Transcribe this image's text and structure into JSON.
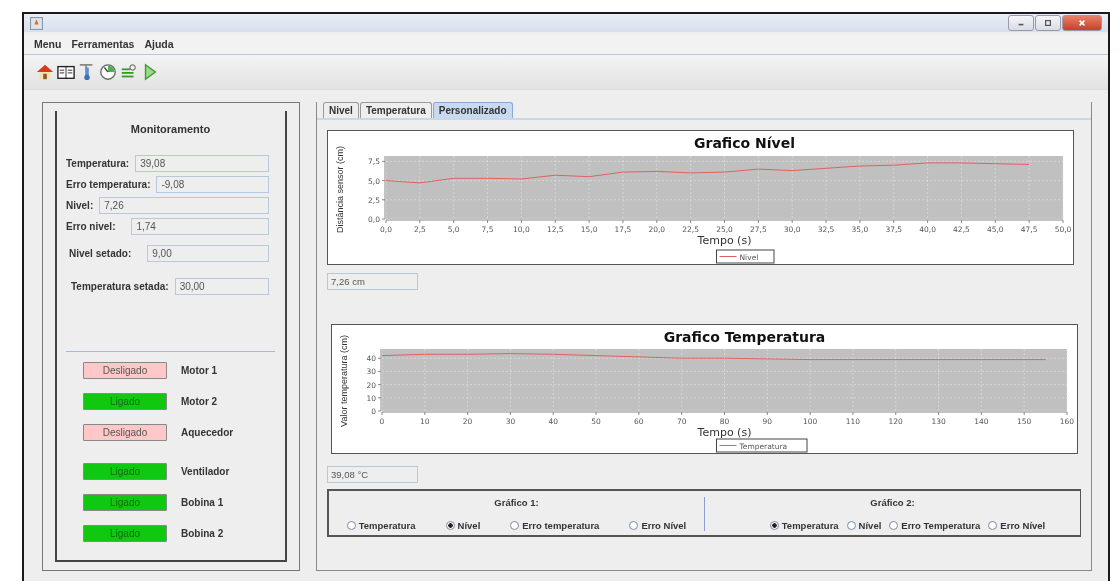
{
  "menu": [
    "Menu",
    "Ferramentas",
    "Ajuda"
  ],
  "monitor": {
    "title": "Monitoramento",
    "fields": [
      {
        "label": "Temperatura:",
        "value": "39,08"
      },
      {
        "label": "Erro temperatura:",
        "value": "-9,08"
      },
      {
        "label": "Nivel:",
        "value": "7,26"
      },
      {
        "label": "Erro nivel:",
        "value": "1,74"
      },
      {
        "label": "Nivel setado:",
        "value": "9,00"
      },
      {
        "label": "Temperatura setada:",
        "value": "30,00"
      }
    ],
    "devices": [
      {
        "button": "Desligado",
        "on": false,
        "name": "Motor 1"
      },
      {
        "button": "Ligado",
        "on": true,
        "name": "Motor 2"
      },
      {
        "button": "Desligado",
        "on": false,
        "name": "Aquecedor"
      },
      {
        "button": "Ligado",
        "on": true,
        "name": "Ventilador"
      },
      {
        "button": "Ligado",
        "on": true,
        "name": "Bobina 1"
      },
      {
        "button": "Ligado",
        "on": true,
        "name": "Bobina 2"
      }
    ]
  },
  "tabs": [
    {
      "label": "Nivel",
      "selected": false
    },
    {
      "label": "Temperatura",
      "selected": false
    },
    {
      "label": "Personalizado",
      "selected": true
    }
  ],
  "charts": [
    {
      "chart_data": {
        "type": "line",
        "title": "Grafico Nível",
        "xlabel": "Tempo (s)",
        "ylabel": "Distância sensor (cm)",
        "x": [
          0,
          2.5,
          5,
          7.5,
          10,
          12.5,
          15,
          17.5,
          20,
          22.5,
          25,
          27.5,
          30,
          32.5,
          35,
          37.5,
          40,
          42.5,
          45,
          47.5
        ],
        "series": [
          {
            "name": "Nivel",
            "color": "#e06060",
            "values": [
              5.0,
              4.7,
              5.3,
              5.3,
              5.2,
              5.7,
              5.5,
              6.1,
              6.2,
              6.0,
              6.1,
              6.5,
              6.3,
              6.6,
              6.9,
              7.0,
              7.3,
              7.3,
              7.2,
              7.1
            ]
          }
        ],
        "xlim": [
          0,
          50
        ],
        "ylim": [
          0,
          8.2
        ],
        "grid": true,
        "xticks": [
          {
            "value": 0,
            "label": "0,0"
          },
          {
            "value": 2.5,
            "label": "2,5"
          },
          {
            "value": 5,
            "label": "5,0"
          },
          {
            "value": 7.5,
            "label": "7,5"
          },
          {
            "value": 10,
            "label": "10,0"
          },
          {
            "value": 12.5,
            "label": "12,5"
          },
          {
            "value": 15,
            "label": "15,0"
          },
          {
            "value": 17.5,
            "label": "17,5"
          },
          {
            "value": 20,
            "label": "20,0"
          },
          {
            "value": 22.5,
            "label": "22,5"
          },
          {
            "value": 25,
            "label": "25,0"
          },
          {
            "value": 27.5,
            "label": "27,5"
          },
          {
            "value": 30,
            "label": "30,0"
          },
          {
            "value": 32.5,
            "label": "32,5"
          },
          {
            "value": 35,
            "label": "35,0"
          },
          {
            "value": 37.5,
            "label": "37,5"
          },
          {
            "value": 40,
            "label": "40,0"
          },
          {
            "value": 42.5,
            "label": "42,5"
          },
          {
            "value": 45,
            "label": "45,0"
          },
          {
            "value": 47.5,
            "label": "47,5"
          },
          {
            "value": 50,
            "label": "50,0"
          }
        ],
        "yticks": [
          {
            "value": 0,
            "label": "0,0"
          },
          {
            "value": 2.5,
            "label": "2,5"
          },
          {
            "value": 5,
            "label": "5,0"
          },
          {
            "value": 7.5,
            "label": "7,5"
          }
        ]
      },
      "reading": "7,26 cm"
    },
    {
      "chart_data": {
        "type": "line",
        "title": "Grafico Temperatura",
        "xlabel": "Tempo (s)",
        "ylabel": "Valor temperatura (cm)",
        "x": [
          0,
          10,
          20,
          30,
          40,
          50,
          60,
          70,
          80,
          90,
          100,
          110,
          120,
          130,
          140,
          150,
          155
        ],
        "series": [
          {
            "name": "Temperatura",
            "color": "#e06060",
            "values": [
              42,
              43,
              43,
              43.5,
              43,
              42,
              41,
              40,
              40,
              39.5,
              39,
              39,
              39,
              39,
              39,
              39,
              39
            ]
          }
        ],
        "xlim": [
          0,
          160
        ],
        "ylim": [
          0,
          47
        ],
        "grid": true,
        "xticks": [
          0,
          10,
          20,
          30,
          40,
          50,
          60,
          70,
          80,
          90,
          100,
          110,
          120,
          130,
          140,
          150,
          160
        ],
        "yticks": [
          0,
          10,
          20,
          30,
          40
        ]
      },
      "reading": "39,08 °C"
    }
  ],
  "selectors": [
    {
      "title": "Gráfico 1:",
      "options": [
        {
          "label": "Temperatura",
          "selected": false
        },
        {
          "label": "Nível",
          "selected": true
        },
        {
          "label": "Erro temperatura",
          "selected": false
        },
        {
          "label": "Erro Nível",
          "selected": false
        }
      ]
    },
    {
      "title": "Gráfico 2:",
      "options": [
        {
          "label": "Temperatura",
          "selected": true
        },
        {
          "label": "Nível",
          "selected": false
        },
        {
          "label": "Erro Temperatura",
          "selected": false
        },
        {
          "label": "Erro Nível",
          "selected": false
        }
      ]
    }
  ]
}
